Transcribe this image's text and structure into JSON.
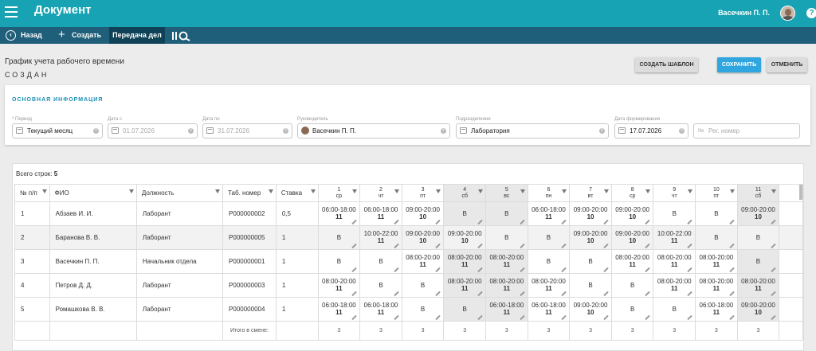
{
  "app": {
    "title": "Документ",
    "user": "Васечкин П. П."
  },
  "toolbar": {
    "back": "Назад",
    "create": "Создать",
    "transfer": "Передача дел"
  },
  "doc": {
    "title": "График учета рабочего времени",
    "status": "СОЗДАН"
  },
  "buttons": {
    "template": "СОЗДАТЬ ШАБЛОН",
    "save": "СОХРАНИТЬ",
    "cancel": "ОТМЕНИТЬ"
  },
  "info": {
    "heading": "ОСНОВНАЯ ИНФОРМАЦИЯ",
    "period_label": "* Период",
    "period": "Текущий месяц",
    "date_from_label": "Дата с",
    "date_from": "01.07.2026",
    "date_to_label": "Дата по",
    "date_to": "31.07.2026",
    "manager_label": "Руководитель",
    "manager": "Васечкин П. П.",
    "dept_label": "Подразделение",
    "dept": "Лаборатория",
    "formed_label": "Дата формирования",
    "formed": "17.07.2026",
    "reg_placeholder": "Рег. номер"
  },
  "grid": {
    "rowcount_label": "Всего строк:",
    "rowcount": "5",
    "headers": {
      "num": "№ п/п",
      "fio": "ФИО",
      "pos": "Должность",
      "tab": "Таб. номер",
      "rate": "Ставка"
    },
    "days": [
      {
        "n": "1",
        "w": "ср"
      },
      {
        "n": "2",
        "w": "чт"
      },
      {
        "n": "3",
        "w": "пт"
      },
      {
        "n": "4",
        "w": "сб"
      },
      {
        "n": "5",
        "w": "вс"
      },
      {
        "n": "6",
        "w": "пн"
      },
      {
        "n": "7",
        "w": "вт"
      },
      {
        "n": "8",
        "w": "ср"
      },
      {
        "n": "9",
        "w": "чт"
      },
      {
        "n": "10",
        "w": "пт"
      },
      {
        "n": "11",
        "w": "сб"
      }
    ],
    "rows": [
      {
        "num": "1",
        "fio": "Абзаев И. И.",
        "pos": "Лаборант",
        "tab": "Р000000002",
        "rate": "0,5",
        "cells": [
          {
            "t": "06:00-18:00",
            "h": "11"
          },
          {
            "t": "06:00-18:00",
            "h": "11"
          },
          {
            "t": "09:00-20:00",
            "h": "10"
          },
          {
            "t": "В",
            "h": ""
          },
          {
            "t": "В",
            "h": ""
          },
          {
            "t": "06:00-18:00",
            "h": "11"
          },
          {
            "t": "09:00-20:00",
            "h": "10"
          },
          {
            "t": "09:00-20:00",
            "h": "10"
          },
          {
            "t": "В",
            "h": ""
          },
          {
            "t": "В",
            "h": ""
          },
          {
            "t": "09:00-20:00",
            "h": "10"
          }
        ]
      },
      {
        "num": "2",
        "fio": "Баранова В. В.",
        "pos": "Лаборант",
        "tab": "Р000000005",
        "rate": "1",
        "cells": [
          {
            "t": "В",
            "h": ""
          },
          {
            "t": "10:00-22:00",
            "h": "11"
          },
          {
            "t": "09:00-20:00",
            "h": "10"
          },
          {
            "t": "09:00-20:00",
            "h": "10"
          },
          {
            "t": "В",
            "h": ""
          },
          {
            "t": "В",
            "h": ""
          },
          {
            "t": "09:00-20:00",
            "h": "10"
          },
          {
            "t": "09:00-20:00",
            "h": "10"
          },
          {
            "t": "10:00-22:00",
            "h": "11"
          },
          {
            "t": "В",
            "h": ""
          },
          {
            "t": "В",
            "h": ""
          }
        ]
      },
      {
        "num": "3",
        "fio": "Васечкин П. П.",
        "pos": "Начальник отдела",
        "tab": "Р000000001",
        "rate": "1",
        "cells": [
          {
            "t": "В",
            "h": ""
          },
          {
            "t": "В",
            "h": ""
          },
          {
            "t": "08:00-20:00",
            "h": "11"
          },
          {
            "t": "08:00-20:00",
            "h": "11"
          },
          {
            "t": "08:00-20:00",
            "h": "11"
          },
          {
            "t": "В",
            "h": ""
          },
          {
            "t": "В",
            "h": ""
          },
          {
            "t": "08:00-20:00",
            "h": "11"
          },
          {
            "t": "08:00-20:00",
            "h": "11"
          },
          {
            "t": "08:00-20:00",
            "h": "11"
          },
          {
            "t": "В",
            "h": ""
          }
        ]
      },
      {
        "num": "4",
        "fio": "Петров Д. Д.",
        "pos": "Лаборант",
        "tab": "Р000000003",
        "rate": "1",
        "cells": [
          {
            "t": "08:00-20:00",
            "h": "11"
          },
          {
            "t": "В",
            "h": ""
          },
          {
            "t": "В",
            "h": ""
          },
          {
            "t": "08:00-20:00",
            "h": "11"
          },
          {
            "t": "08:00-20:00",
            "h": "11"
          },
          {
            "t": "08:00-20:00",
            "h": "11"
          },
          {
            "t": "В",
            "h": ""
          },
          {
            "t": "В",
            "h": ""
          },
          {
            "t": "08:00-20:00",
            "h": "11"
          },
          {
            "t": "08:00-20:00",
            "h": "11"
          },
          {
            "t": "08:00-20:00",
            "h": "11"
          }
        ]
      },
      {
        "num": "5",
        "fio": "Ромашкова В. В.",
        "pos": "Лаборант",
        "tab": "Р000000004",
        "rate": "1",
        "cells": [
          {
            "t": "06:00-18:00",
            "h": "11"
          },
          {
            "t": "06:00-18:00",
            "h": "11"
          },
          {
            "t": "В",
            "h": ""
          },
          {
            "t": "В",
            "h": ""
          },
          {
            "t": "06:00-18:00",
            "h": "11"
          },
          {
            "t": "06:00-18:00",
            "h": "11"
          },
          {
            "t": "09:00-20:00",
            "h": "10"
          },
          {
            "t": "В",
            "h": ""
          },
          {
            "t": "В",
            "h": ""
          },
          {
            "t": "06:00-18:00",
            "h": "11"
          },
          {
            "t": "09:00-20:00",
            "h": "10"
          }
        ]
      }
    ],
    "footer_label": "Итого в смене:",
    "footer_values": [
      "3",
      "3",
      "3",
      "3",
      "3",
      "3",
      "3",
      "3",
      "3",
      "3",
      "3"
    ]
  }
}
